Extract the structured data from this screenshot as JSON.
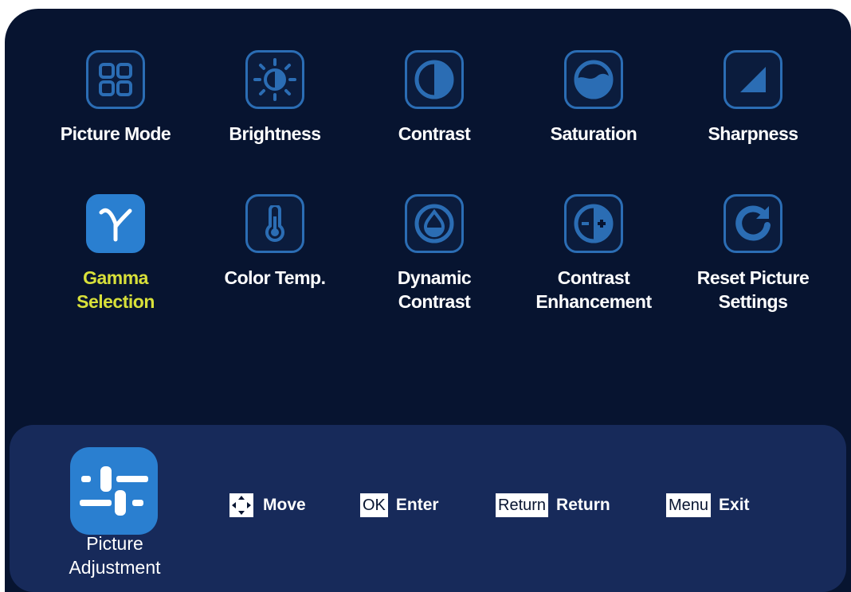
{
  "menu": {
    "items": [
      {
        "label": "Picture Mode",
        "icon": "grid-icon"
      },
      {
        "label": "Brightness",
        "icon": "brightness-icon"
      },
      {
        "label": "Contrast",
        "icon": "contrast-icon"
      },
      {
        "label": "Saturation",
        "icon": "saturation-icon"
      },
      {
        "label": "Sharpness",
        "icon": "sharpness-icon"
      },
      {
        "label": "Gamma\nSelection",
        "icon": "gamma-icon",
        "selected": true
      },
      {
        "label": "Color Temp.",
        "icon": "thermometer-icon"
      },
      {
        "label": "Dynamic\nContrast",
        "icon": "drop-icon"
      },
      {
        "label": "Contrast\nEnhancement",
        "icon": "contrast-plus-icon"
      },
      {
        "label": "Reset Picture\nSettings",
        "icon": "reset-icon"
      }
    ]
  },
  "footer": {
    "section_label": "Picture\nAdjustment",
    "section_icon": "sliders-icon",
    "hints": {
      "move": {
        "key_icon": "dpad-icon",
        "text": "Move"
      },
      "ok": {
        "key": "OK",
        "text": "Enter"
      },
      "return": {
        "key": "Return",
        "text": "Return"
      },
      "menu": {
        "key": "Menu",
        "text": "Exit"
      }
    }
  },
  "colors": {
    "background": "#071430",
    "accent": "#2a7fd0",
    "selected_text": "#d8e03a",
    "footer_bg": "#172a5a"
  }
}
